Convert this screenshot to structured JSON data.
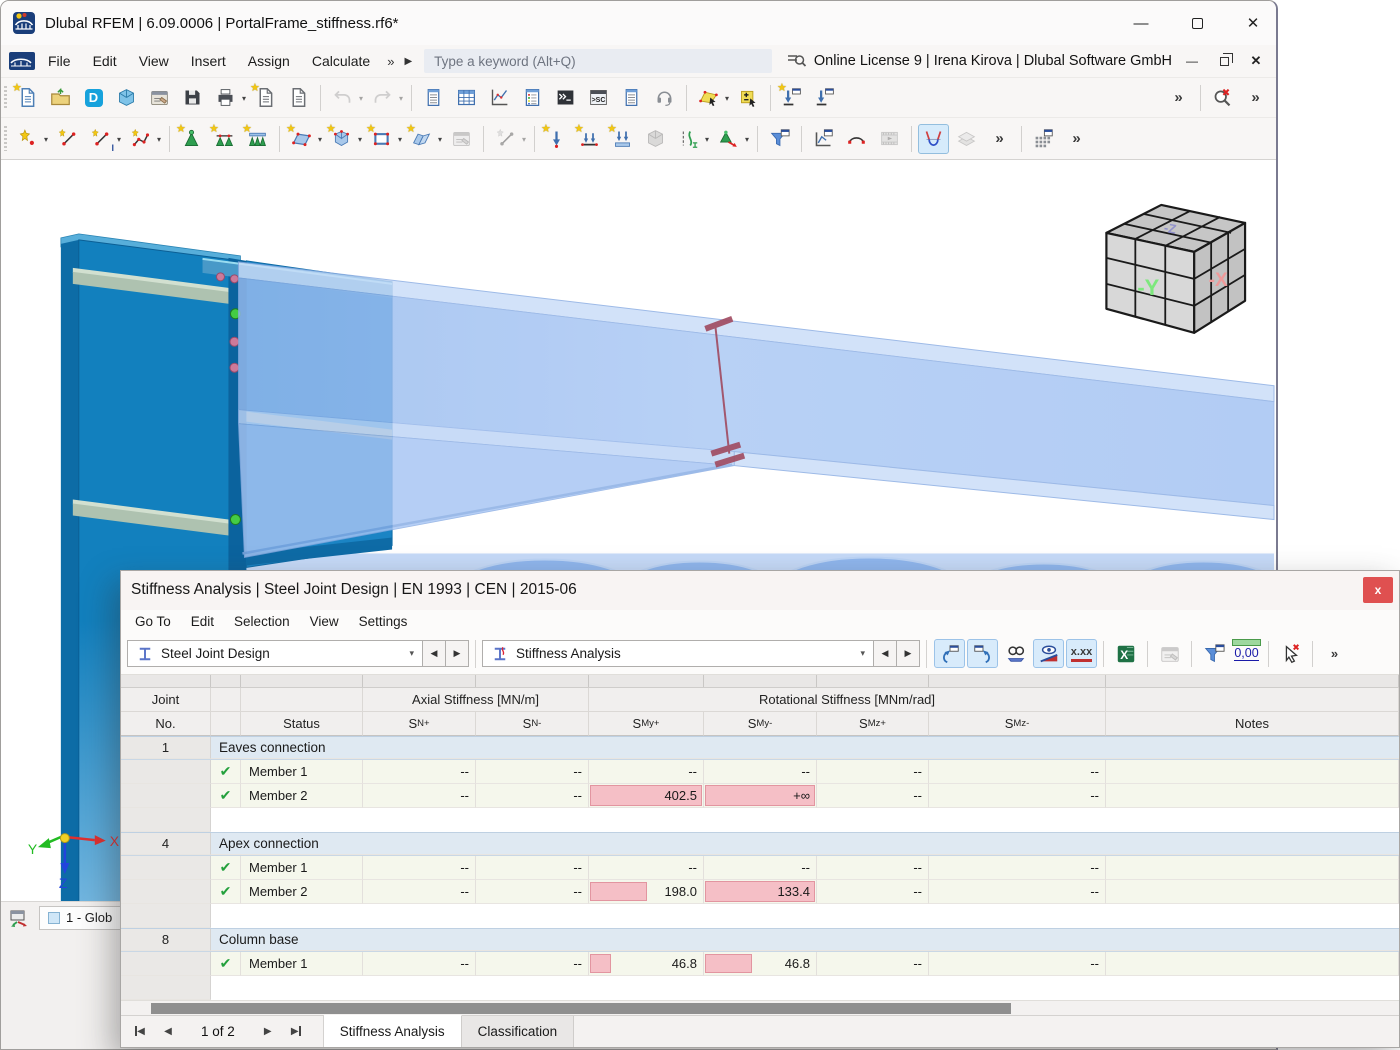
{
  "window": {
    "title": "Dlubal RFEM | 6.09.0006 | PortalFrame_stiffness.rf6*"
  },
  "menubar": {
    "items": [
      "File",
      "Edit",
      "View",
      "Insert",
      "Assign",
      "Calculate"
    ],
    "overflow": "»",
    "expand": "▶",
    "search_placeholder": "Type a keyword (Alt+Q)",
    "license_text": "Online License 9 | Irena Kirova | Dlubal Software GmbH"
  },
  "toolbar_main": {
    "items": [
      {
        "n": "new-model-button",
        "s": "page",
        "tint": "#4d7fb5",
        "star": true
      },
      {
        "n": "open-model-button",
        "s": "folder"
      },
      {
        "n": "dlubal-cloud-button",
        "t": "D",
        "bg": "#17a2dc"
      },
      {
        "n": "model-manager-button",
        "s": "cube"
      },
      {
        "n": "printout-report-manager-button",
        "s": "report"
      },
      {
        "n": "save-button",
        "s": "floppy"
      },
      {
        "n": "print-button",
        "s": "printer",
        "dd": true
      },
      {
        "n": "new-printout-report-button",
        "s": "page",
        "tint": "#6b6e73",
        "star": true
      },
      {
        "n": "show-printout-report-button",
        "s": "page",
        "tint": "#6b6e73"
      },
      {
        "sep": true
      },
      {
        "n": "undo-button",
        "s": "undo",
        "tint": "#9aa0a8",
        "dd": true,
        "dis": true
      },
      {
        "n": "redo-button",
        "s": "redo",
        "tint": "#9aa0a8",
        "dd": true,
        "dis": true
      },
      {
        "sep": true
      },
      {
        "n": "navigator-panel-button",
        "s": "panel"
      },
      {
        "n": "tables-button",
        "s": "grid"
      },
      {
        "n": "diagrams-button",
        "s": "chart"
      },
      {
        "n": "result-tables-button",
        "s": "panelcolor"
      },
      {
        "n": "console-button",
        "s": "console"
      },
      {
        "n": "script-console-button",
        "s": "sc"
      },
      {
        "n": "display-panel-button",
        "s": "panel"
      },
      {
        "n": "support-chat-button",
        "s": "headset"
      },
      {
        "sep": true
      },
      {
        "n": "edit-surface-button",
        "s": "plane",
        "dd": true
      },
      {
        "n": "edit-parameters-button",
        "s": "plusbox"
      },
      {
        "sep": true
      },
      {
        "n": "insert-above-button",
        "s": "insarrow",
        "star": true
      },
      {
        "n": "insert-below-button",
        "s": "insarrow"
      },
      {
        "sp": true
      },
      {
        "n": "toolbar-overflow-button",
        "t": "»"
      },
      {
        "sep": true
      },
      {
        "n": "close-views-button",
        "s": "magx"
      },
      {
        "n": "toolbar-overflow-2-button",
        "t": "»"
      }
    ]
  },
  "toolbar_insert": {
    "items": [
      {
        "n": "new-node-button",
        "s": "starnode",
        "dd": true
      },
      {
        "n": "new-line-button",
        "s": "starline"
      },
      {
        "n": "new-member-button",
        "s": "starline",
        "sub": "I",
        "dd": true
      },
      {
        "n": "new-polyline-button",
        "s": "polyline",
        "dd": true
      },
      {
        "sep": true
      },
      {
        "n": "new-nodal-support-button",
        "s": "cone",
        "star": true
      },
      {
        "n": "new-line-support-button",
        "s": "cones2",
        "star": true
      },
      {
        "n": "new-surface-support-button",
        "s": "cones3",
        "star": true
      },
      {
        "sep": true
      },
      {
        "n": "new-surface-button",
        "s": "surface",
        "star": true,
        "dd": true
      },
      {
        "n": "new-solid-button",
        "s": "solid",
        "star": true,
        "dd": true
      },
      {
        "n": "new-opening-button",
        "s": "opening",
        "star": true,
        "dd": true
      },
      {
        "n": "new-block-button",
        "s": "fold",
        "star": true,
        "dd": true
      },
      {
        "n": "copy-object-button",
        "s": "report",
        "dis": true
      },
      {
        "sep": true
      },
      {
        "n": "new-special-object-button",
        "s": "starline",
        "dis": true,
        "dd": true
      },
      {
        "sep": true
      },
      {
        "n": "new-nodal-load-button",
        "s": "loadarrow",
        "star": true
      },
      {
        "n": "new-member-load-button",
        "s": "loadarrows",
        "star": true
      },
      {
        "n": "new-line-load-button",
        "s": "loadarrows2",
        "star": true
      },
      {
        "n": "new-solid-load-button",
        "s": "cube",
        "dis": true
      },
      {
        "n": "new-imposed-deformation-button",
        "s": "deform",
        "dd": true
      },
      {
        "n": "new-support-displacement-button",
        "s": "conearrow",
        "dd": true
      },
      {
        "sep": true
      },
      {
        "n": "filter-objects-button",
        "s": "funnelwin"
      },
      {
        "sep": true
      },
      {
        "n": "result-diagrams-button",
        "s": "chartwin"
      },
      {
        "n": "section-results-button",
        "s": "arcsec"
      },
      {
        "n": "animation-button",
        "s": "film",
        "dis": true
      },
      {
        "sep": true
      },
      {
        "n": "show-results-button",
        "s": "ucurve",
        "act": true
      },
      {
        "n": "result-layers-button",
        "s": "layers",
        "dis": true
      },
      {
        "n": "toolbar2-overflow-button",
        "t": "»"
      },
      {
        "sep": true
      },
      {
        "n": "result-grid-button",
        "s": "gridwin"
      },
      {
        "n": "toolbar2-overflow-2-button",
        "t": "»"
      }
    ]
  },
  "viewport": {
    "navigation_cube": {
      "left_face": "-Y",
      "right_face": "-X",
      "top_face": "-Z"
    },
    "axes": {
      "x": "X",
      "y": "Y",
      "z": "Z"
    },
    "view_tab": {
      "label": "1 - Glob"
    }
  },
  "dialog": {
    "title": "Stiffness Analysis | Steel Joint Design | EN 1993 | CEN | 2015-06",
    "close_label": "x",
    "menu": [
      "Go To",
      "Edit",
      "Selection",
      "View",
      "Settings"
    ],
    "toolbar": {
      "design_combo": "Steel Joint Design",
      "result_combo": "Stiffness Analysis",
      "icons": [
        {
          "n": "jump-to-previous-button",
          "s": "jumpback",
          "act": true
        },
        {
          "n": "jump-to-next-button",
          "s": "jumpfwd",
          "act": true
        },
        {
          "n": "view-mode-button",
          "s": "glasses"
        },
        {
          "n": "show-values-button",
          "s": "eyeslope",
          "act": true
        },
        {
          "n": "decimal-places-button",
          "t": "x.xx",
          "act": true,
          "cls": "xdec"
        },
        {
          "sep": true
        },
        {
          "n": "export-excel-button",
          "s": "excel"
        },
        {
          "sep": true
        },
        {
          "n": "printout-report-button",
          "s": "report",
          "dis": true
        },
        {
          "sep": true
        },
        {
          "n": "filter-results-button",
          "s": "funnelwin"
        },
        {
          "n": "units-settings-button",
          "t": "0,00",
          "cls": "units"
        },
        {
          "sep": true
        },
        {
          "n": "deselect-button",
          "s": "cursorx"
        },
        {
          "sep": true
        },
        {
          "n": "dialog-toolbar-overflow-button",
          "t": "»"
        }
      ]
    },
    "table": {
      "header": {
        "joint": [
          "Joint",
          "No."
        ],
        "status": "Status",
        "axial_group": "Axial Stiffness [MN/m]",
        "rotational_group": "Rotational Stiffness [MNm/rad]",
        "columns": [
          {
            "base": "S",
            "sub": "N+"
          },
          {
            "base": "S",
            "sub": "N-"
          },
          {
            "base": "S",
            "sub": "My+"
          },
          {
            "base": "S",
            "sub": "My-"
          },
          {
            "base": "S",
            "sub": "Mz+"
          },
          {
            "base": "S",
            "sub": "Mz-"
          }
        ],
        "notes": "Notes"
      },
      "groups": [
        {
          "no": "1",
          "title": "Eaves connection",
          "members": [
            {
              "label": "Member 1",
              "status": "✔",
              "values": [
                {
                  "text": "--"
                },
                {
                  "text": "--"
                },
                {
                  "text": "--"
                },
                {
                  "text": "--"
                },
                {
                  "text": "--"
                },
                {
                  "text": "--"
                }
              ],
              "notes": ""
            },
            {
              "label": "Member 2",
              "status": "✔",
              "values": [
                {
                  "text": "--"
                },
                {
                  "text": "--"
                },
                {
                  "text": "402.5",
                  "bar": 1
                },
                {
                  "text": "+∞",
                  "bar": 1
                },
                {
                  "text": "--"
                },
                {
                  "text": "--"
                }
              ],
              "notes": ""
            }
          ]
        },
        {
          "no": "4",
          "title": "Apex connection",
          "members": [
            {
              "label": "Member 1",
              "status": "✔",
              "values": [
                {
                  "text": "--"
                },
                {
                  "text": "--"
                },
                {
                  "text": "--"
                },
                {
                  "text": "--"
                },
                {
                  "text": "--"
                },
                {
                  "text": "--"
                }
              ],
              "notes": ""
            },
            {
              "label": "Member 2",
              "status": "✔",
              "values": [
                {
                  "text": "--"
                },
                {
                  "text": "--"
                },
                {
                  "text": "198.0",
                  "bar": 0.5
                },
                {
                  "text": "133.4",
                  "bar": 1
                },
                {
                  "text": "--"
                },
                {
                  "text": "--"
                }
              ],
              "notes": ""
            }
          ]
        },
        {
          "no": "8",
          "title": "Column base",
          "members": [
            {
              "label": "Member 1",
              "status": "✔",
              "values": [
                {
                  "text": "--"
                },
                {
                  "text": "--"
                },
                {
                  "text": "46.8",
                  "bar": 0.18
                },
                {
                  "text": "46.8",
                  "bar": 0.42
                },
                {
                  "text": "--"
                },
                {
                  "text": "--"
                }
              ],
              "notes": ""
            }
          ]
        }
      ]
    },
    "pager": {
      "label": "1 of 2"
    },
    "tabs": [
      {
        "label": "Stiffness Analysis",
        "active": true
      },
      {
        "label": "Classification",
        "active": false
      }
    ]
  },
  "colors": {
    "steel_solid": "#1b84c4",
    "steel_translucent": "#a6c4f3",
    "bar_pink": "#f5bfc6",
    "group_row": "#dfe9f2",
    "member_row": "#f5f7ec",
    "close_red": "#df5050",
    "active_tool": "#d6ebfb"
  }
}
